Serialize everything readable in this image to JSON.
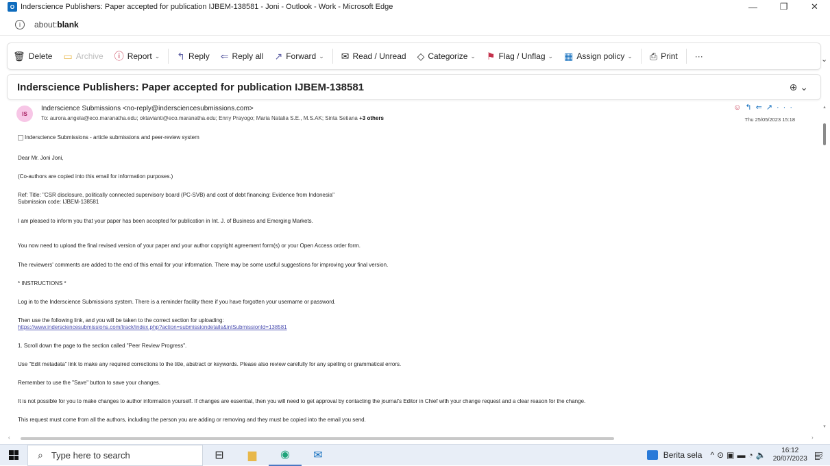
{
  "window": {
    "title": "Inderscience Publishers: Paper accepted for publication IJBEM-138581 - Joni - Outlook - Work - Microsoft Edge",
    "app_icon_text": "O",
    "minimize": "—",
    "restore": "❐",
    "close": "✕"
  },
  "address": {
    "info": "i",
    "prefix": "about:",
    "bold": "blank"
  },
  "toolbar": {
    "delete": "Delete",
    "archive": "Archive",
    "report": "Report",
    "reply": "Reply",
    "reply_all": "Reply all",
    "forward": "Forward",
    "read_unread": "Read / Unread",
    "categorize": "Categorize",
    "flag": "Flag / Unflag",
    "assign_policy": "Assign policy",
    "print": "Print",
    "more": "···"
  },
  "subject": "Inderscience Publishers: Paper accepted for publication IJBEM-138581",
  "message": {
    "avatar_initials": "IS",
    "sender": "Inderscience Submissions <no-reply@indersciencesubmissions.com>",
    "to_label": "To:",
    "recipients": "aurora.angela@eco.maranatha.edu;  oktavianti@eco.maranatha.edu;  Enny Prayogo;  Maria Natalia S.E., M.S.AK;  Sinta Setiana",
    "others": "+3 others",
    "date": "Thu 25/05/2023 15:18",
    "img_alt": "Inderscience Submissions - article submissions and peer-review system",
    "greeting": "Dear Mr. Joni Joni,",
    "coauthors": "(Co-authors are copied into this email for information purposes.)",
    "ref_title": "Ref: Title: \"CSR disclosure, politically connected supervisory board (PC-SVB) and cost of debt financing: Evidence from Indonesia\"",
    "submission_code": "Submission code: IJBEM-138581",
    "accepted": "I am pleased to inform you that your paper has been accepted for publication in Int. J. of Business and Emerging Markets.",
    "upload": "You now need to upload the final revised version of your paper and your author copyright agreement form(s) or your Open Access order form.",
    "reviewers": "The reviewers' comments are added to the end of this email for your information. There may be some useful suggestions for improving your final version.",
    "instructions": "* INSTRUCTIONS *",
    "login": "Log in to the Inderscience Submissions system. There is a reminder facility there if you have forgotten your username or password.",
    "link_intro": "Then use the following link, and you will be taken to the correct section for uploading:",
    "link": "https://www.indersciencesubmissions.com/track/index.php?action=submissiondetails&intSubmissionId=138581",
    "step1": "1. Scroll down the page to the section called \"Peer Review Progress\".",
    "edit_metadata": "Use \"Edit metadata\" link to make any required corrections to the title, abstract or keywords. Please also review carefully for any spelling or grammatical errors.",
    "save": "Remember to use the \"Save\" button to save your changes.",
    "author_info": "It is not possible for you to make changes to author information yourself. If changes are essential, then you will need to get approval by contacting the journal's Editor in Chief with your change request and a clear reason for the change.",
    "request": "This request must come from all the authors, including the person you are adding or removing and they must be copied into the email you send."
  },
  "taskbar": {
    "search_placeholder": "Type here to search",
    "news": "Berita sela",
    "time": "16:12",
    "date": "20/07/2023",
    "notifications": "2"
  },
  "icons": {
    "delete": "trash-icon",
    "archive": "archive-icon",
    "report": "report-icon",
    "reply": "reply-icon",
    "reply_all": "reply-all-icon",
    "forward": "forward-icon",
    "read_unread": "envelope-open-icon",
    "categorize": "tag-icon",
    "flag": "flag-icon",
    "assign_policy": "policy-icon",
    "print": "printer-icon"
  },
  "colors": {
    "accent": "#0f6cbd",
    "link": "#4f52b2",
    "report": "#c4314b",
    "flag": "#c4314b"
  }
}
